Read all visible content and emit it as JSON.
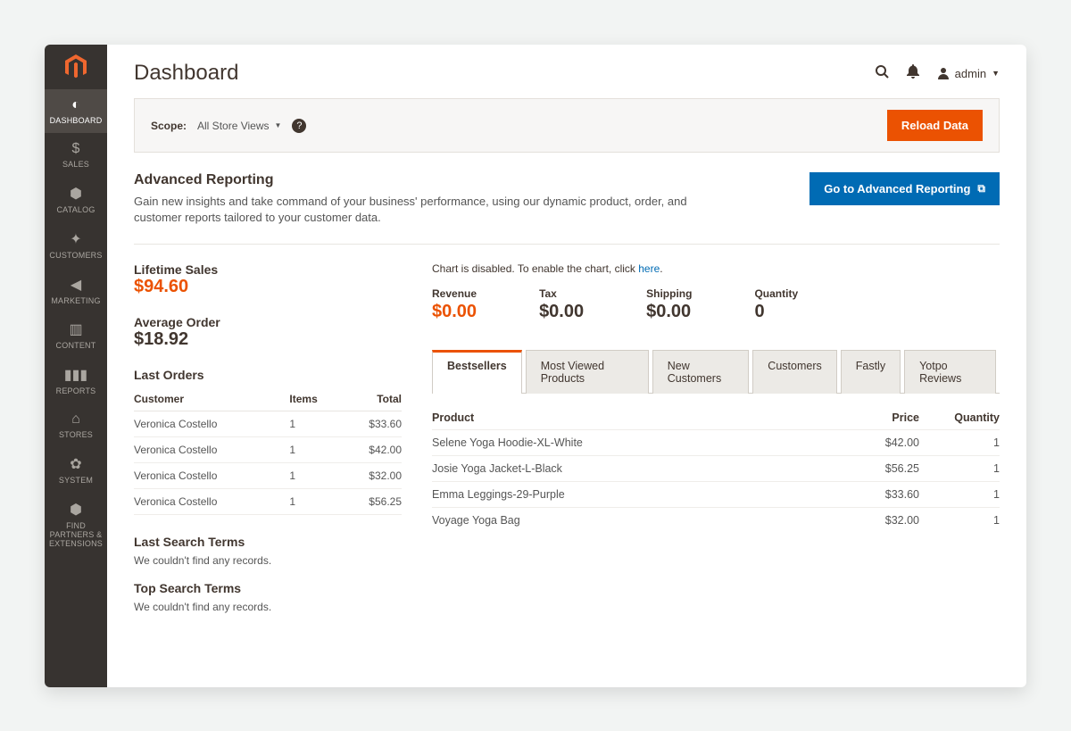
{
  "header": {
    "title": "Dashboard",
    "admin_label": "admin"
  },
  "scope": {
    "label": "Scope:",
    "selected": "All Store Views",
    "reload_label": "Reload Data"
  },
  "sidebar": {
    "items": [
      {
        "id": "dashboard",
        "label": "DASHBOARD",
        "icon": "gauge"
      },
      {
        "id": "sales",
        "label": "SALES",
        "icon": "dollar"
      },
      {
        "id": "catalog",
        "label": "CATALOG",
        "icon": "cube"
      },
      {
        "id": "customers",
        "label": "CUSTOMERS",
        "icon": "person"
      },
      {
        "id": "marketing",
        "label": "MARKETING",
        "icon": "megaphone"
      },
      {
        "id": "content",
        "label": "CONTENT",
        "icon": "layout"
      },
      {
        "id": "reports",
        "label": "REPORTS",
        "icon": "bars"
      },
      {
        "id": "stores",
        "label": "STORES",
        "icon": "store"
      },
      {
        "id": "system",
        "label": "SYSTEM",
        "icon": "gear"
      },
      {
        "id": "find-partners",
        "label": "FIND PARTNERS & EXTENSIONS",
        "icon": "partners"
      }
    ]
  },
  "advanced": {
    "title": "Advanced Reporting",
    "desc": "Gain new insights and take command of your business' performance, using our dynamic product, order, and customer reports tailored to your customer data.",
    "cta": "Go to Advanced Reporting"
  },
  "stats": {
    "lifetime_label": "Lifetime Sales",
    "lifetime_value": "$94.60",
    "avg_label": "Average Order",
    "avg_value": "$18.92"
  },
  "last_orders": {
    "title": "Last Orders",
    "cols": {
      "customer": "Customer",
      "items": "Items",
      "total": "Total"
    },
    "rows": [
      {
        "customer": "Veronica Costello",
        "items": "1",
        "total": "$33.60"
      },
      {
        "customer": "Veronica Costello",
        "items": "1",
        "total": "$42.00"
      },
      {
        "customer": "Veronica Costello",
        "items": "1",
        "total": "$32.00"
      },
      {
        "customer": "Veronica Costello",
        "items": "1",
        "total": "$56.25"
      }
    ]
  },
  "last_search": {
    "title": "Last Search Terms",
    "empty": "We couldn't find any records."
  },
  "top_search": {
    "title": "Top Search Terms",
    "empty": "We couldn't find any records."
  },
  "chart_note": {
    "prefix": "Chart is disabled. To enable the chart, click ",
    "link": "here",
    "suffix": "."
  },
  "metrics": [
    {
      "label": "Revenue",
      "value": "$0.00",
      "highlight": true
    },
    {
      "label": "Tax",
      "value": "$0.00"
    },
    {
      "label": "Shipping",
      "value": "$0.00"
    },
    {
      "label": "Quantity",
      "value": "0"
    }
  ],
  "tabs": [
    {
      "id": "bestsellers",
      "label": "Bestsellers",
      "active": true
    },
    {
      "id": "most-viewed",
      "label": "Most Viewed Products"
    },
    {
      "id": "new-customers",
      "label": "New Customers"
    },
    {
      "id": "customers",
      "label": "Customers"
    },
    {
      "id": "fastly",
      "label": "Fastly"
    },
    {
      "id": "yotpo",
      "label": "Yotpo Reviews"
    }
  ],
  "bestsellers": {
    "cols": {
      "product": "Product",
      "price": "Price",
      "quantity": "Quantity"
    },
    "rows": [
      {
        "product": "Selene Yoga Hoodie-XL-White",
        "price": "$42.00",
        "quantity": "1"
      },
      {
        "product": "Josie Yoga Jacket-L-Black",
        "price": "$56.25",
        "quantity": "1"
      },
      {
        "product": "Emma Leggings-29-Purple",
        "price": "$33.60",
        "quantity": "1"
      },
      {
        "product": "Voyage Yoga Bag",
        "price": "$32.00",
        "quantity": "1"
      }
    ]
  }
}
